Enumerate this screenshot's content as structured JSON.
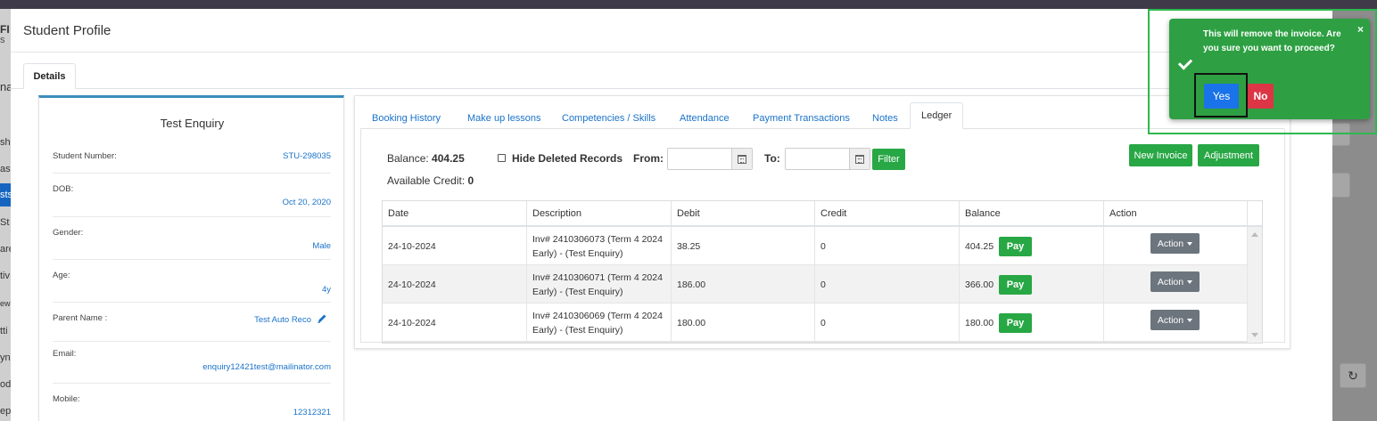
{
  "modal": {
    "title": "Student Profile",
    "details_tab": "Details"
  },
  "background": {
    "left_fragments": [
      "FI",
      "S",
      "na",
      "sh",
      "ass",
      "sts",
      "St",
      "are",
      "tiv",
      "ew",
      "tti",
      "yn",
      "od",
      "epo"
    ]
  },
  "profile": {
    "name": "Test Enquiry",
    "rows": [
      {
        "label": "Student Number:",
        "value": "STU-298035"
      },
      {
        "label": "DOB:",
        "value": "Oct 20, 2020"
      },
      {
        "label": "Gender:",
        "value": "Male"
      },
      {
        "label": "Age:",
        "value": "4y"
      },
      {
        "label": "Parent Name :",
        "value": "Test Auto Reco"
      },
      {
        "label": "Email:",
        "value": "enquiry12421test@mailinator.com"
      },
      {
        "label": "Mobile:",
        "value": "12312321"
      }
    ]
  },
  "tabs": [
    "Booking History",
    "Make up lessons",
    "Competencies / Skills",
    "Attendance",
    "Payment Transactions",
    "Notes",
    "Ledger"
  ],
  "ledger": {
    "balance_label": "Balance:",
    "balance_value": "404.25",
    "credit_label": "Available Credit:",
    "credit_value": "0",
    "hide_deleted_label": "Hide Deleted Records",
    "hide_deleted_checked": false,
    "from_label": "From:",
    "from_value": "",
    "to_label": "To:",
    "to_value": "",
    "filter_label": "Filter",
    "new_invoice_label": "New Invoice",
    "adjustment_label": "Adjustment",
    "columns": [
      "Date",
      "Description",
      "Debit",
      "Credit",
      "Balance",
      "Action"
    ],
    "rows": [
      {
        "date": "24-10-2024",
        "desc1": "Inv# 2410306073 (Term 4 2024",
        "desc2": "Early) - (Test Enquiry)",
        "debit": "38.25",
        "credit": "0",
        "balance": "404.25",
        "pay": "Pay",
        "action": "Action"
      },
      {
        "date": "24-10-2024",
        "desc1": "Inv# 2410306071 (Term 4 2024",
        "desc2": "Early) - (Test Enquiry)",
        "debit": "186.00",
        "credit": "0",
        "balance": "366.00",
        "pay": "Pay",
        "action": "Action"
      },
      {
        "date": "24-10-2024",
        "desc1": "Inv# 2410306069 (Term 4 2024",
        "desc2": "Early) - (Test Enquiry)",
        "debit": "180.00",
        "credit": "0",
        "balance": "180.00",
        "pay": "Pay",
        "action": "Action"
      }
    ]
  },
  "toast": {
    "message": "This will remove the invoice. Are you sure you want to proceed?",
    "close": "×",
    "yes_label": "Yes",
    "no_label": "No"
  },
  "colors": {
    "primary": "#1a73c9",
    "success": "#28a745",
    "danger": "#dc3545",
    "secondary": "#6c757d",
    "toast": "#2ea043"
  },
  "icons": [
    "calendar-icon",
    "pencil-icon",
    "check-icon",
    "close-icon",
    "caret-down-icon",
    "refresh-icon"
  ]
}
